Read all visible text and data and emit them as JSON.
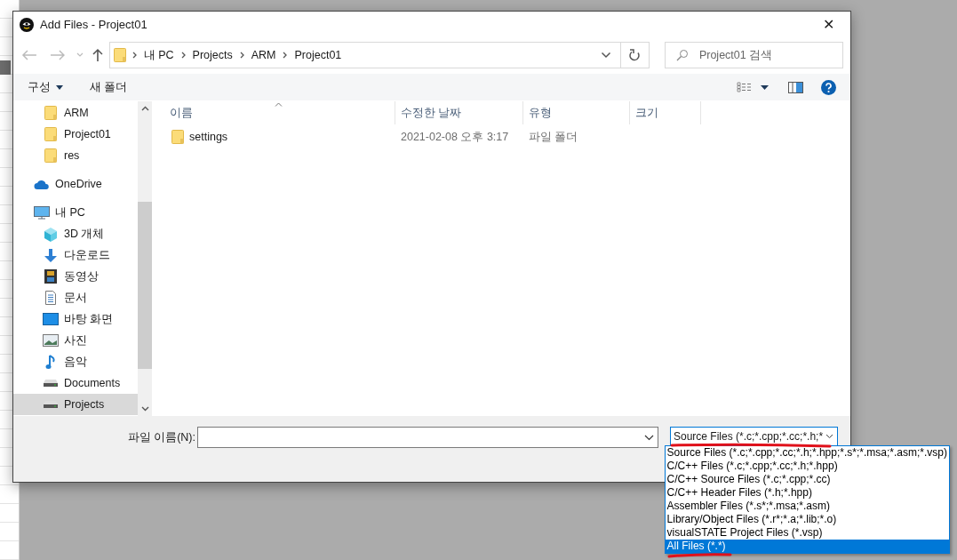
{
  "window": {
    "title": "Add Files - Project01",
    "close": "✕"
  },
  "address": {
    "path": [
      {
        "label": "내 PC"
      },
      {
        "label": "Projects"
      },
      {
        "label": "ARM"
      },
      {
        "label": "Project01"
      }
    ]
  },
  "search": {
    "placeholder": "Project01 검색"
  },
  "toolbar": {
    "organize": "구성",
    "new_folder": "새 폴더"
  },
  "sidebar": {
    "items": [
      {
        "children": [
          {
            "label": "ARM",
            "kind": "folder",
            "selected": false
          },
          {
            "label": "Project01",
            "kind": "folder",
            "selected": false
          },
          {
            "label": "res",
            "kind": "folder",
            "selected": false
          }
        ]
      },
      {
        "label": "OneDrive",
        "kind": "cloud",
        "selected": false
      },
      {
        "label": "내 PC",
        "kind": "pc",
        "selected": false,
        "children": [
          {
            "label": "3D 개체",
            "kind": "cube",
            "selected": false
          },
          {
            "label": "다운로드",
            "kind": "download",
            "selected": false
          },
          {
            "label": "동영상",
            "kind": "video",
            "selected": false
          },
          {
            "label": "문서",
            "kind": "document",
            "selected": false
          },
          {
            "label": "바탕 화면",
            "kind": "desktop",
            "selected": false
          },
          {
            "label": "사진",
            "kind": "image",
            "selected": false
          },
          {
            "label": "음악",
            "kind": "music",
            "selected": false
          },
          {
            "label": "Documents",
            "kind": "drive",
            "selected": false
          },
          {
            "label": "Projects",
            "kind": "drive",
            "selected": true
          }
        ]
      }
    ]
  },
  "table": {
    "columns": [
      "이름",
      "수정한 날짜",
      "유형",
      "크기"
    ],
    "rows": [
      {
        "name": "settings",
        "modified": "2021-02-08 오후 3:17",
        "type": "파일 폴더"
      }
    ]
  },
  "footer": {
    "filename_label": "파일 이름(N):",
    "filetype": "Source Files (*.c;*.cpp;*.cc;*.h;*"
  },
  "filetype_options": [
    {
      "label": "Source Files (*.c;*.cpp;*.cc;*.h;*.hpp;*.s*;*.msa;*.asm;*.vsp)",
      "selected": false
    },
    {
      "label": "C/C++ Files (*.c;*.cpp;*.cc;*.h;*.hpp)",
      "selected": false
    },
    {
      "label": "C/C++ Source Files (*.c;*.cpp;*.cc)",
      "selected": false
    },
    {
      "label": "C/C++ Header Files (*.h;*.hpp)",
      "selected": false
    },
    {
      "label": "Assembler Files (*.s*;*.msa;*.asm)",
      "selected": false
    },
    {
      "label": "Library/Object Files (*.r*;*.a;*.lib;*.o)",
      "selected": false
    },
    {
      "label": "visualSTATE Project Files (*.vsp)",
      "selected": false
    },
    {
      "label": "All Files (*.*)",
      "selected": true
    }
  ]
}
